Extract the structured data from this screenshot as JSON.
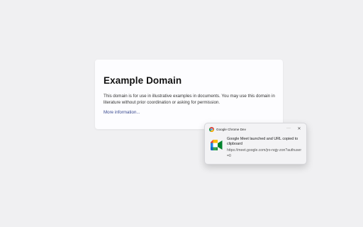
{
  "page": {
    "title": "Example Domain",
    "description": "This domain is for use in illustrative examples in documents. You may use this domain in literature without prior coordination or asking for permission.",
    "link_text": "More information..."
  },
  "notification": {
    "app_name": "Google Chrome Dev",
    "app_icon": "chrome-dev-icon",
    "more_label": "···",
    "close_label": "✕",
    "image_icon": "google-meet-icon",
    "message": "Google Meet launched and URL copied to clipboard",
    "url": "https://meet.google.com/jro-nqjy-zon?authuser=0"
  },
  "colors": {
    "background": "#f0f0f2",
    "card": "#fdfdff",
    "link": "#38488f",
    "toast_background": "#f3f3f5"
  }
}
